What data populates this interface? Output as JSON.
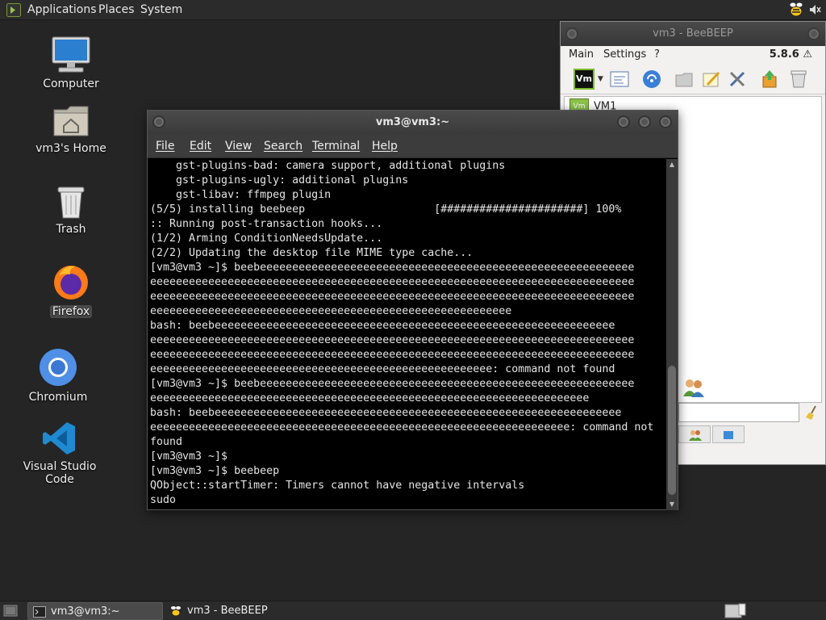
{
  "top_panel": {
    "menus": [
      "Applications",
      "Places",
      "System"
    ]
  },
  "desktop": {
    "icons": [
      {
        "label": "Computer"
      },
      {
        "label": "vm3's Home"
      },
      {
        "label": "Trash"
      },
      {
        "label": "Firefox"
      },
      {
        "label": "Chromium"
      },
      {
        "label": "Visual Studio Code"
      }
    ]
  },
  "beebeep": {
    "title": "vm3 - BeeBEEP",
    "menus": [
      "Main",
      "Settings",
      "?"
    ],
    "version": "5.8.6",
    "user_name": "VM1",
    "status_badge": "Vm"
  },
  "terminal": {
    "title": "vm3@vm3:~",
    "menus": [
      "File",
      "Edit",
      "View",
      "Search",
      "Terminal",
      "Help"
    ],
    "lines": [
      "    gst-plugins-bad: camera support, additional plugins",
      "    gst-plugins-ugly: additional plugins",
      "    gst-libav: ffmpeg plugin",
      "(5/5) installing beebeep                    [######################] 100%",
      ":: Running post-transaction hooks...",
      "(1/2) Arming ConditionNeedsUpdate...",
      "(2/2) Updating the desktop file MIME type cache...",
      "[vm3@vm3 ~]$ beebeeeeeeeeeeeeeeeeeeeeeeeeeeeeeeeeeeeeeeeeeeeeeeeeeeeeeeeeee",
      "eeeeeeeeeeeeeeeeeeeeeeeeeeeeeeeeeeeeeeeeeeeeeeeeeeeeeeeeeeeeeeeeeeeeeeeeeee",
      "eeeeeeeeeeeeeeeeeeeeeeeeeeeeeeeeeeeeeeeeeeeeeeeeeeeeeeeeeeeeeeeeeeeeeeeeeee",
      "eeeeeeeeeeeeeeeeeeeeeeeeeeeeeeeeeeeeeeeeeeeeeeeeeeeeeeee",
      "bash: beebeeeeeeeeeeeeeeeeeeeeeeeeeeeeeeeeeeeeeeeeeeeeeeeeeeeeeeeeeeeeee",
      "eeeeeeeeeeeeeeeeeeeeeeeeeeeeeeeeeeeeeeeeeeeeeeeeeeeeeeeeeeeeeeeeeeeeeeeeeee",
      "eeeeeeeeeeeeeeeeeeeeeeeeeeeeeeeeeeeeeeeeeeeeeeeeeeeeeeeeeeeeeeeeeeeeeeeeeee",
      "eeeeeeeeeeeeeeeeeeeeeeeeeeeeeeeeeeeeeeeeeeeeeeeeeeeee: command not found",
      "[vm3@vm3 ~]$ beebeeeeeeeeeeeeeeeeeeeeeeeeeeeeeeeeeeeeeeeeeeeeeeeeeeeeeeeeee",
      "eeeeeeeeeeeeeeeeeeeeeeeeeeeeeeeeeeeeeeeeeeeeeeeeeeeeeeeeeeeeeeeeeeee",
      "bash: beebeeeeeeeeeeeeeeeeeeeeeeeeeeeeeeeeeeeeeeeeeeeeeeeeeeeeeeeeeeeeeee",
      "eeeeeeeeeeeeeeeeeeeeeeeeeeeeeeeeeeeeeeeeeeeeeeeeeeeeeeeeeeeeeeeee: command not",
      "found",
      "[vm3@vm3 ~]$",
      "[vm3@vm3 ~]$ beebeep",
      "QObject::startTimer: Timers cannot have negative intervals",
      "sudo"
    ]
  },
  "taskbar": {
    "tasks": [
      {
        "label": "vm3@vm3:~"
      },
      {
        "label": "vm3 - BeeBEEP"
      }
    ]
  }
}
